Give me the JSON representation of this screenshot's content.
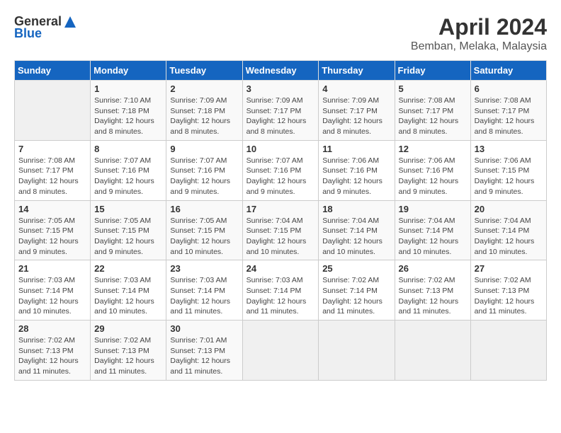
{
  "header": {
    "logo_general": "General",
    "logo_blue": "Blue",
    "month_title": "April 2024",
    "location": "Bemban, Melaka, Malaysia"
  },
  "weekdays": [
    "Sunday",
    "Monday",
    "Tuesday",
    "Wednesday",
    "Thursday",
    "Friday",
    "Saturday"
  ],
  "weeks": [
    [
      {
        "day": "",
        "sunrise": "",
        "sunset": "",
        "daylight": ""
      },
      {
        "day": "1",
        "sunrise": "7:10 AM",
        "sunset": "7:18 PM",
        "daylight": "12 hours and 8 minutes."
      },
      {
        "day": "2",
        "sunrise": "7:09 AM",
        "sunset": "7:18 PM",
        "daylight": "12 hours and 8 minutes."
      },
      {
        "day": "3",
        "sunrise": "7:09 AM",
        "sunset": "7:17 PM",
        "daylight": "12 hours and 8 minutes."
      },
      {
        "day": "4",
        "sunrise": "7:09 AM",
        "sunset": "7:17 PM",
        "daylight": "12 hours and 8 minutes."
      },
      {
        "day": "5",
        "sunrise": "7:08 AM",
        "sunset": "7:17 PM",
        "daylight": "12 hours and 8 minutes."
      },
      {
        "day": "6",
        "sunrise": "7:08 AM",
        "sunset": "7:17 PM",
        "daylight": "12 hours and 8 minutes."
      }
    ],
    [
      {
        "day": "7",
        "sunrise": "7:08 AM",
        "sunset": "7:17 PM",
        "daylight": "12 hours and 8 minutes."
      },
      {
        "day": "8",
        "sunrise": "7:07 AM",
        "sunset": "7:16 PM",
        "daylight": "12 hours and 9 minutes."
      },
      {
        "day": "9",
        "sunrise": "7:07 AM",
        "sunset": "7:16 PM",
        "daylight": "12 hours and 9 minutes."
      },
      {
        "day": "10",
        "sunrise": "7:07 AM",
        "sunset": "7:16 PM",
        "daylight": "12 hours and 9 minutes."
      },
      {
        "day": "11",
        "sunrise": "7:06 AM",
        "sunset": "7:16 PM",
        "daylight": "12 hours and 9 minutes."
      },
      {
        "day": "12",
        "sunrise": "7:06 AM",
        "sunset": "7:16 PM",
        "daylight": "12 hours and 9 minutes."
      },
      {
        "day": "13",
        "sunrise": "7:06 AM",
        "sunset": "7:15 PM",
        "daylight": "12 hours and 9 minutes."
      }
    ],
    [
      {
        "day": "14",
        "sunrise": "7:05 AM",
        "sunset": "7:15 PM",
        "daylight": "12 hours and 9 minutes."
      },
      {
        "day": "15",
        "sunrise": "7:05 AM",
        "sunset": "7:15 PM",
        "daylight": "12 hours and 9 minutes."
      },
      {
        "day": "16",
        "sunrise": "7:05 AM",
        "sunset": "7:15 PM",
        "daylight": "12 hours and 10 minutes."
      },
      {
        "day": "17",
        "sunrise": "7:04 AM",
        "sunset": "7:15 PM",
        "daylight": "12 hours and 10 minutes."
      },
      {
        "day": "18",
        "sunrise": "7:04 AM",
        "sunset": "7:14 PM",
        "daylight": "12 hours and 10 minutes."
      },
      {
        "day": "19",
        "sunrise": "7:04 AM",
        "sunset": "7:14 PM",
        "daylight": "12 hours and 10 minutes."
      },
      {
        "day": "20",
        "sunrise": "7:04 AM",
        "sunset": "7:14 PM",
        "daylight": "12 hours and 10 minutes."
      }
    ],
    [
      {
        "day": "21",
        "sunrise": "7:03 AM",
        "sunset": "7:14 PM",
        "daylight": "12 hours and 10 minutes."
      },
      {
        "day": "22",
        "sunrise": "7:03 AM",
        "sunset": "7:14 PM",
        "daylight": "12 hours and 10 minutes."
      },
      {
        "day": "23",
        "sunrise": "7:03 AM",
        "sunset": "7:14 PM",
        "daylight": "12 hours and 11 minutes."
      },
      {
        "day": "24",
        "sunrise": "7:03 AM",
        "sunset": "7:14 PM",
        "daylight": "12 hours and 11 minutes."
      },
      {
        "day": "25",
        "sunrise": "7:02 AM",
        "sunset": "7:14 PM",
        "daylight": "12 hours and 11 minutes."
      },
      {
        "day": "26",
        "sunrise": "7:02 AM",
        "sunset": "7:13 PM",
        "daylight": "12 hours and 11 minutes."
      },
      {
        "day": "27",
        "sunrise": "7:02 AM",
        "sunset": "7:13 PM",
        "daylight": "12 hours and 11 minutes."
      }
    ],
    [
      {
        "day": "28",
        "sunrise": "7:02 AM",
        "sunset": "7:13 PM",
        "daylight": "12 hours and 11 minutes."
      },
      {
        "day": "29",
        "sunrise": "7:02 AM",
        "sunset": "7:13 PM",
        "daylight": "12 hours and 11 minutes."
      },
      {
        "day": "30",
        "sunrise": "7:01 AM",
        "sunset": "7:13 PM",
        "daylight": "12 hours and 11 minutes."
      },
      {
        "day": "",
        "sunrise": "",
        "sunset": "",
        "daylight": ""
      },
      {
        "day": "",
        "sunrise": "",
        "sunset": "",
        "daylight": ""
      },
      {
        "day": "",
        "sunrise": "",
        "sunset": "",
        "daylight": ""
      },
      {
        "day": "",
        "sunrise": "",
        "sunset": "",
        "daylight": ""
      }
    ]
  ],
  "labels": {
    "sunrise_prefix": "Sunrise: ",
    "sunset_prefix": "Sunset: ",
    "daylight_prefix": "Daylight: "
  }
}
